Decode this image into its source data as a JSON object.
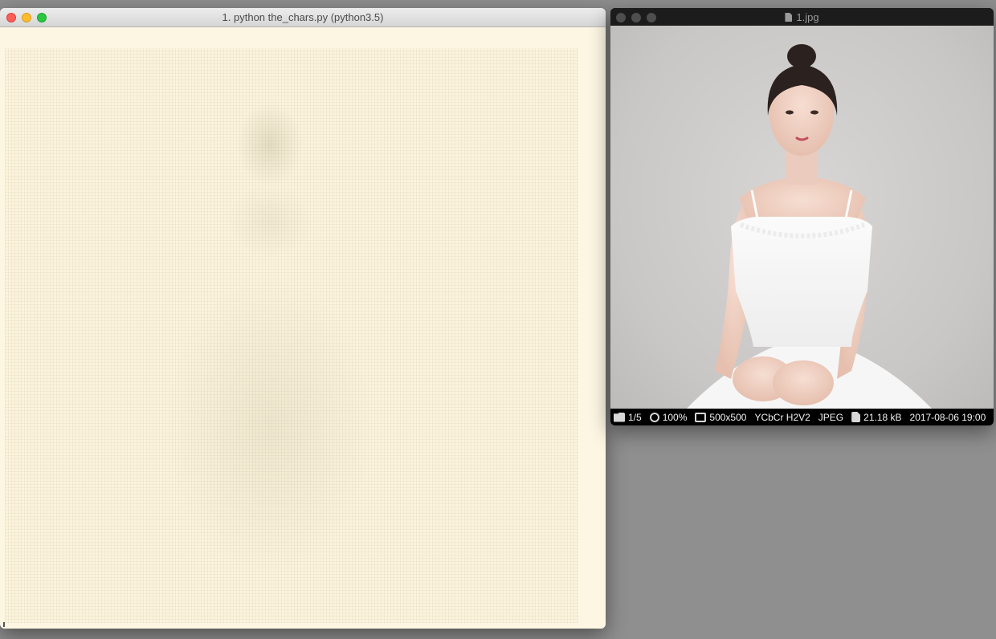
{
  "terminal": {
    "title": "1. python the_chars.py (python3.5)"
  },
  "viewer": {
    "title": "1.jpg",
    "status": {
      "index": "1/5",
      "zoom": "100%",
      "dimensions": "500x500",
      "colorspace": "YCbCr H2V2",
      "format": "JPEG",
      "filesize": "21.18 kB",
      "date": "2017-08-06 19:00"
    }
  },
  "colors": {
    "terminal_bg": "#fdf6e3",
    "desktop_bg": "#8f8f8f",
    "viewer_bg": "#000000"
  },
  "icons": [
    "close-icon",
    "minimize-icon",
    "zoom-icon",
    "document-icon",
    "folder-icon",
    "magnifier-icon",
    "fit-icon",
    "file-icon"
  ]
}
